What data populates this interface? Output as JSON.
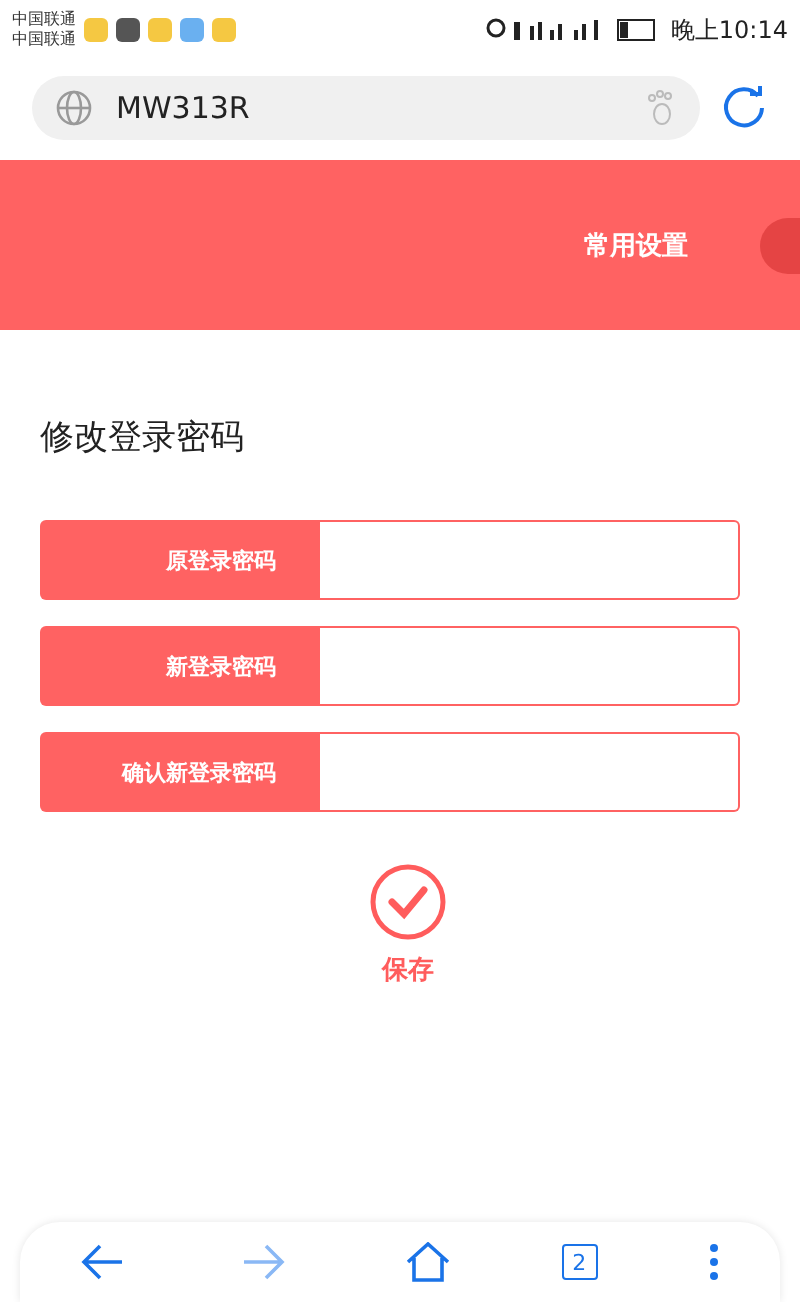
{
  "status_bar": {
    "carriers": [
      "中国联通",
      "中国联通"
    ],
    "time": "晚上10:14"
  },
  "address_bar": {
    "url": "MW313R"
  },
  "header": {
    "tabs": [
      {
        "label": "常用设置",
        "selected": false
      },
      {
        "selected": true
      }
    ]
  },
  "form": {
    "title": "修改登录密码",
    "fields": [
      {
        "label": "原登录密码"
      },
      {
        "label": "新登录密码"
      },
      {
        "label": "确认新登录密码"
      }
    ],
    "save_label": "保存"
  },
  "bottom_bar": {
    "tab_count": "2",
    "forward_disabled": true
  }
}
